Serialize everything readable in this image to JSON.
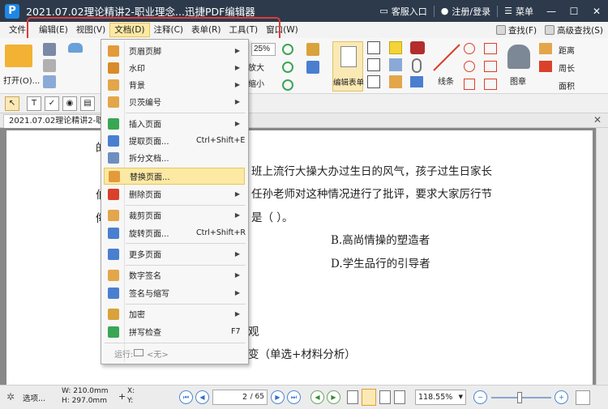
{
  "window": {
    "title": "2021.07.02理论精讲2-职业理念...迅捷PDF编辑器",
    "logo": "P",
    "customer_service": "客服入口",
    "login": "注册/登录",
    "menu": "菜单"
  },
  "menubar": {
    "items": [
      "文件",
      "编辑(E)",
      "视图(V)",
      "文档(D)",
      "注释(C)",
      "表单(R)",
      "工具(T)",
      "窗口(W)"
    ],
    "find": "查找(F)",
    "advanced_find": "高级查找(S)"
  },
  "ribbon": {
    "open": "打开(O)...",
    "zoom_value": "25%",
    "zoom_in": "放大",
    "zoom_out": "缩小",
    "edit_form": "编辑表单",
    "line": "线条",
    "stamp": "图章",
    "distance": "距离",
    "perimeter": "周长",
    "area": "面积"
  },
  "doc_tab": {
    "title": "2021.07.02理论精讲2-职业理"
  },
  "document": {
    "lines": [
      "的",
      "班上流行大操大办过生日的风气，孩子过生日家长",
      "任孙老师对这种情况进行了批评，要求大家厉行节",
      "是（  ）。",
      "B.高尚情操的塑造者",
      "D.学生品行的引导者",
      "观",
      "变（单选+材料分析）"
    ],
    "left_fragments": [
      "伯",
      "侮"
    ]
  },
  "dropdown": {
    "items": [
      {
        "label": "页眉页脚",
        "shortcut": "",
        "submenu": true,
        "icon": "header-footer-icon",
        "color": "#e39a3a"
      },
      {
        "label": "水印",
        "shortcut": "",
        "submenu": true,
        "icon": "watermark-icon",
        "color": "#d98b2b"
      },
      {
        "label": "背景",
        "shortcut": "",
        "submenu": true,
        "icon": "background-icon",
        "color": "#e3a64a"
      },
      {
        "label": "贝茨编号",
        "shortcut": "",
        "submenu": true,
        "icon": "bates-icon",
        "color": "#e3a64a"
      },
      {
        "label": "插入页面",
        "shortcut": "",
        "submenu": true,
        "icon": "insert-page-icon",
        "color": "#3aa655"
      },
      {
        "label": "提取页面...",
        "shortcut": "Ctrl+Shift+E",
        "submenu": false,
        "icon": "extract-page-icon",
        "color": "#4a7fd0"
      },
      {
        "label": "拆分文档...",
        "shortcut": "",
        "submenu": false,
        "icon": "split-icon",
        "color": "#6d8fbf"
      },
      {
        "label": "替换页面...",
        "shortcut": "",
        "submenu": false,
        "icon": "replace-page-icon",
        "color": "#e39a3a"
      },
      {
        "label": "删除页面",
        "shortcut": "",
        "submenu": true,
        "icon": "delete-page-icon",
        "color": "#d9412b"
      },
      {
        "label": "裁剪页面",
        "shortcut": "",
        "submenu": true,
        "icon": "crop-icon",
        "color": "#e3a64a"
      },
      {
        "label": "旋转页面...",
        "shortcut": "Ctrl+Shift+R",
        "submenu": false,
        "icon": "rotate-page-icon",
        "color": "#4a7fd0"
      },
      {
        "label": "更多页面",
        "shortcut": "",
        "submenu": true,
        "icon": "more-pages-icon",
        "color": "#4a7fd0"
      },
      {
        "label": "数字签名",
        "shortcut": "",
        "submenu": true,
        "icon": "digital-signature-icon",
        "color": "#e3a64a"
      },
      {
        "label": "签名与缩写",
        "shortcut": "",
        "submenu": true,
        "icon": "signature-icon",
        "color": "#4a7fd0"
      },
      {
        "label": "加密",
        "shortcut": "",
        "submenu": true,
        "icon": "encrypt-icon",
        "color": "#d9a23a"
      },
      {
        "label": "拼写检查",
        "shortcut": "F7",
        "submenu": false,
        "icon": "spellcheck-icon",
        "color": "#3aa655"
      }
    ],
    "run_label": "运行:",
    "run_value": "<无>"
  },
  "statusbar": {
    "options": "选项...",
    "width": "W: 210.0mm",
    "height": "H: 297.0mm",
    "x": "X:",
    "y": "Y:",
    "page_current": "2",
    "page_total": "/ 65",
    "zoom": "118.55%"
  },
  "colors": {
    "titlebar": "#2d3a4b",
    "highlight": "#fce9a4",
    "annotation_box": "#e03b3b",
    "accent_blue": "#1e88e5"
  }
}
